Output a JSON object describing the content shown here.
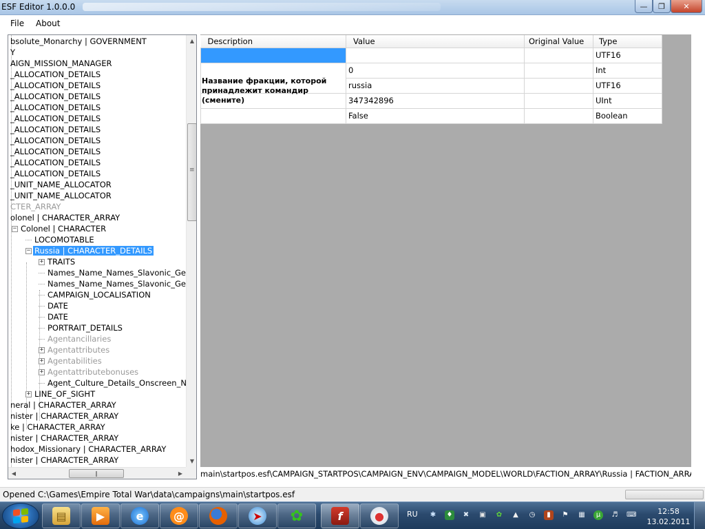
{
  "window": {
    "title": "ESF Editor 1.0.0.0"
  },
  "menu": {
    "file": "File",
    "about": "About"
  },
  "tree": {
    "nodes": [
      {
        "label": "bsolute_Monarchy | GOVERNMENT",
        "gray": false
      },
      {
        "label": "Y",
        "gray": false
      },
      {
        "label": "AIGN_MISSION_MANAGER",
        "gray": false
      },
      {
        "label": "_ALLOCATION_DETAILS",
        "gray": false
      },
      {
        "label": "_ALLOCATION_DETAILS",
        "gray": false
      },
      {
        "label": "_ALLOCATION_DETAILS",
        "gray": false
      },
      {
        "label": "_ALLOCATION_DETAILS",
        "gray": false
      },
      {
        "label": "_ALLOCATION_DETAILS",
        "gray": false
      },
      {
        "label": "_ALLOCATION_DETAILS",
        "gray": false
      },
      {
        "label": "_ALLOCATION_DETAILS",
        "gray": false
      },
      {
        "label": "_ALLOCATION_DETAILS",
        "gray": false
      },
      {
        "label": "_ALLOCATION_DETAILS",
        "gray": false
      },
      {
        "label": "_ALLOCATION_DETAILS",
        "gray": false
      },
      {
        "label": "_UNIT_NAME_ALLOCATOR",
        "gray": false
      },
      {
        "label": "_UNIT_NAME_ALLOCATOR",
        "gray": false
      },
      {
        "label": "CTER_ARRAY",
        "gray": true
      },
      {
        "label": "olonel | CHARACTER_ARRAY",
        "gray": false
      },
      {
        "label": "Colonel | CHARACTER",
        "gray": false
      },
      {
        "label": "LOCOMOTABLE",
        "gray": false
      },
      {
        "label": "Russia | CHARACTER_DETAILS",
        "gray": false
      },
      {
        "label": "TRAITS",
        "gray": false
      },
      {
        "label": "Names_Name_Names_Slavonic_Generalmajor",
        "gray": false
      },
      {
        "label": "Names_Name_Names_Slavonic_Generaltolmasov",
        "gray": false
      },
      {
        "label": "CAMPAIGN_LOCALISATION",
        "gray": false
      },
      {
        "label": "DATE",
        "gray": false
      },
      {
        "label": "DATE",
        "gray": false
      },
      {
        "label": "PORTRAIT_DETAILS",
        "gray": false
      },
      {
        "label": "Agentancillaries",
        "gray": true
      },
      {
        "label": "Agentattributes",
        "gray": true
      },
      {
        "label": "Agentabilities",
        "gray": true
      },
      {
        "label": "Agentattributebonuses",
        "gray": true
      },
      {
        "label": "Agent_Culture_Details_Onscreen_Name_Colonel",
        "gray": false
      },
      {
        "label": "LINE_OF_SIGHT",
        "gray": false
      },
      {
        "label": "neral | CHARACTER_ARRAY",
        "gray": false
      },
      {
        "label": "nister | CHARACTER_ARRAY",
        "gray": false
      },
      {
        "label": "ke | CHARACTER_ARRAY",
        "gray": false
      },
      {
        "label": "nister | CHARACTER_ARRAY",
        "gray": false
      },
      {
        "label": "hodox_Missionary | CHARACTER_ARRAY",
        "gray": false
      },
      {
        "label": "nister | CHARACTER_ARRAY",
        "gray": false
      }
    ]
  },
  "grid": {
    "headers": [
      "Description",
      "Value",
      "Original Value",
      "Type"
    ],
    "rows": [
      {
        "description": "",
        "value": "",
        "original": "",
        "type": "UTF16"
      },
      {
        "description": "",
        "value": "0",
        "original": "",
        "type": "Int"
      },
      {
        "description": "Название фракции, которой принадлежит командир (смените)",
        "value": "russia",
        "original": "",
        "type": "UTF16"
      },
      {
        "description": "",
        "value": "347342896",
        "original": "",
        "type": "UInt"
      },
      {
        "description": "",
        "value": "False",
        "original": "",
        "type": "Boolean"
      }
    ]
  },
  "path": "main\\startpos.esf\\CAMPAIGN_STARTPOS\\CAMPAIGN_ENV\\CAMPAIGN_MODEL\\WORLD\\FACTION_ARRAY\\Russia | FACTION_ARRAY\\Russia",
  "status": {
    "message": "Opened C:\\Games\\Empire Total War\\data\\campaigns\\main\\startpos.esf"
  },
  "taskbar": {
    "apps": [
      "explorer-icon",
      "media-player-icon",
      "internet-explorer-icon",
      "at-mail-icon",
      "firefox-icon",
      "safari-compass-icon",
      "icq-flower-icon",
      "flash-tools-icon",
      "paint-palette-icon"
    ],
    "lang": "RU",
    "time": "12:58",
    "date": "13.02.2011"
  },
  "colors": {
    "selection": "#3399ff",
    "grid_bg": "#ababab"
  }
}
